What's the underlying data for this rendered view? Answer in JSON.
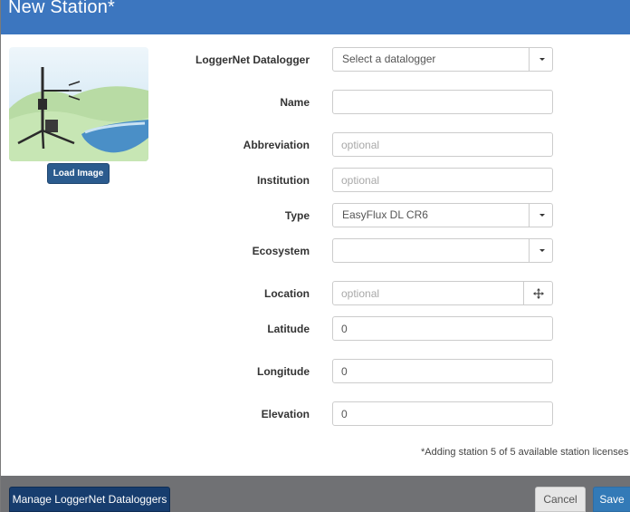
{
  "window": {
    "title": "New Station*"
  },
  "image": {
    "load_label": "Load Image"
  },
  "form": {
    "datalogger": {
      "label": "LoggerNet Datalogger",
      "value": "Select a datalogger"
    },
    "name": {
      "label": "Name",
      "value": "",
      "placeholder": ""
    },
    "abbreviation": {
      "label": "Abbreviation",
      "value": "",
      "placeholder": "optional"
    },
    "institution": {
      "label": "Institution",
      "value": "",
      "placeholder": "optional"
    },
    "type": {
      "label": "Type",
      "value": "EasyFlux DL CR6"
    },
    "ecosystem": {
      "label": "Ecosystem",
      "value": ""
    },
    "location": {
      "label": "Location",
      "value": "",
      "placeholder": "optional"
    },
    "latitude": {
      "label": "Latitude",
      "value": "0"
    },
    "longitude": {
      "label": "Longitude",
      "value": "0"
    },
    "elevation": {
      "label": "Elevation",
      "value": "0"
    }
  },
  "license_note": "*Adding station 5 of 5 available station licenses",
  "footer": {
    "manage_label": "Manage LoggerNet Dataloggers",
    "cancel_label": "Cancel",
    "save_label": "Save"
  },
  "colors": {
    "title_bar": "#3c76bf",
    "footer": "#707174",
    "primary_button": "#337ab7",
    "dark_button": "#173d6e"
  }
}
